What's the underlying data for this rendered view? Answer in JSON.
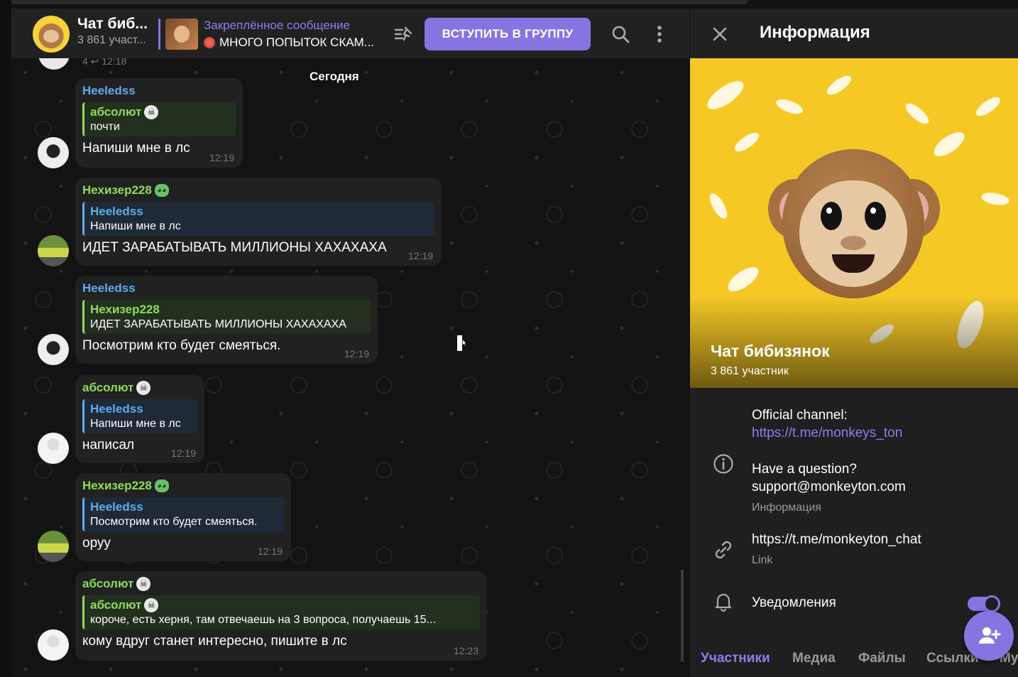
{
  "header": {
    "chat_title": "Чат биб...",
    "chat_subtitle": "3 861 участ...",
    "pinned_title": "Закреплённое сообщение",
    "pinned_text": "МНОГО ПОПЫТОК СКАМ...",
    "join_label": "ВСТУПИТЬ В ГРУППУ",
    "icons": [
      "pinned-list-icon",
      "search-icon",
      "more-vert-icon"
    ]
  },
  "chat": {
    "date_label": "Сегодня",
    "top_clipped_meta": "4 ↩ 12:18",
    "messages": [
      {
        "sender": "Heeledss",
        "reply_name": "абсолют",
        "reply_text": "почти",
        "body": "Напиши мне в лс",
        "time": "12:19"
      },
      {
        "sender": "Нехизер228",
        "reply_name": "Heeledss",
        "reply_text": "Напиши мне в лс",
        "body": "ИДЕТ ЗАРАБАТЫВАТЬ МИЛЛИОНЫ ХАХАХАХА",
        "time": "12:19"
      },
      {
        "sender": "Heeledss",
        "reply_name": "Нехизер228",
        "reply_text": "ИДЕТ ЗАРАБАТЫВАТЬ МИЛЛИОНЫ ХАХАХАХА",
        "body": "Посмотрим кто будет смеяться.",
        "time": "12:19"
      },
      {
        "sender": "абсолют",
        "reply_name": "Heeledss",
        "reply_text": "Напиши мне в лс",
        "body": "написал",
        "time": "12:19"
      },
      {
        "sender": "Нехизер228",
        "reply_name": "Heeledss",
        "reply_text": "Посмотрим кто будет смеяться.",
        "body": "оруу",
        "time": "12:19"
      },
      {
        "sender": "абсолют",
        "reply_name": "абсолют",
        "reply_text": "короче, есть херня, там отвечаешь на 3 вопроса, получаешь 15...",
        "body": "кому вдруг станет интересно, пишите в лс",
        "time": "12:23"
      }
    ]
  },
  "panel": {
    "title": "Информация",
    "group_name": "Чат бибизянок",
    "member_count": "3 861 участник",
    "description_line1": "Official channel:",
    "description_link": "https://t.me/monkeys_ton",
    "description_line2": "Have a question?",
    "description_line3": "support@monkeyton.com",
    "description_caption": "Информация",
    "link_value": "https://t.me/monkeyton_chat",
    "link_caption": "Link",
    "notifications_label": "Уведомления",
    "notifications_on": true,
    "tabs": [
      "Участники",
      "Медиа",
      "Файлы",
      "Ссылки",
      "Му"
    ],
    "active_tab": "Участники"
  },
  "colors": {
    "accent": "#8774e1",
    "name_blue": "#5eacf0",
    "name_green": "#8fdc5c",
    "cover_yellow": "#f5c826"
  }
}
